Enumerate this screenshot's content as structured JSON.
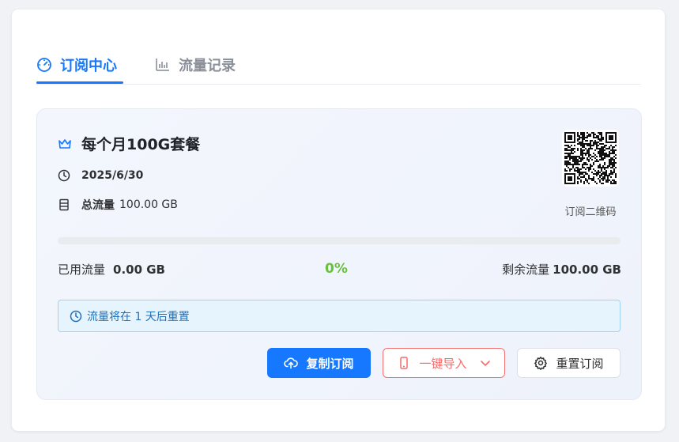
{
  "tabs": {
    "subscription": "订阅中心",
    "traffic": "流量记录"
  },
  "plan": {
    "name": "每个月100G套餐",
    "expire_date": "2025/6/30",
    "total_label": "总流量",
    "total_value": "100.00 GB"
  },
  "qr": {
    "label": "订阅二维码"
  },
  "usage": {
    "used_label": "已用流量",
    "used_value": "0.00 GB",
    "percent": "0%",
    "percent_value": 0,
    "remain_label": "剩余流量",
    "remain_value": "100.00 GB"
  },
  "alert": {
    "text": "流量将在 1 天后重置"
  },
  "buttons": {
    "copy": "复制订阅",
    "import": "一键导入",
    "reset": "重置订阅"
  },
  "icons": {
    "tab_subscription": "gauge-icon",
    "tab_traffic": "bar-chart-icon",
    "plan": "crown-icon",
    "expire": "clock-icon",
    "total": "database-icon",
    "alert": "clock-icon",
    "copy": "cloud-upload-icon",
    "import": "phone-icon",
    "import_chevron": "chevron-down-icon",
    "reset": "gear-icon"
  },
  "colors": {
    "accent": "#1677ff",
    "success": "#67c23a",
    "danger": "#f56c6c",
    "info_text": "#1f6fb8"
  }
}
